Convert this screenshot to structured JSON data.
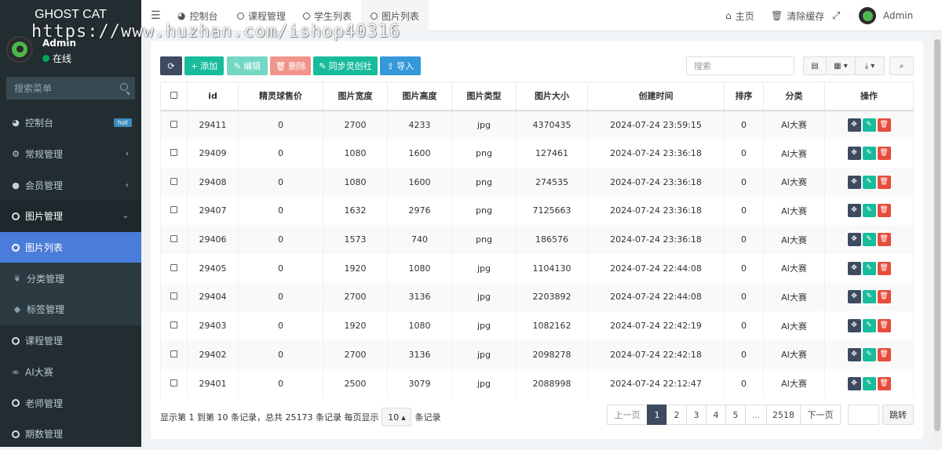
{
  "app": {
    "title": "GHOST CAT",
    "watermark": "https://www.huzhan.com/ishop40316"
  },
  "user": {
    "name": "Admin",
    "status": "在线"
  },
  "sidebar": {
    "search_placeholder": "搜索菜单",
    "items": [
      {
        "label": "控制台",
        "icon": "dashboard-icon",
        "badge": "hot"
      },
      {
        "label": "常规管理",
        "icon": "cogs-icon"
      },
      {
        "label": "会员管理",
        "icon": "user-circle-icon"
      },
      {
        "label": "图片管理",
        "icon": "circle-icon"
      },
      {
        "label": "图片列表",
        "icon": "circle-icon"
      },
      {
        "label": "分类管理",
        "icon": "leaf-icon"
      },
      {
        "label": "标签管理",
        "icon": "tag-icon"
      },
      {
        "label": "课程管理",
        "icon": "circle-icon"
      },
      {
        "label": "AI大赛",
        "icon": "binoculars-icon"
      },
      {
        "label": "老师管理",
        "icon": "circle-icon"
      },
      {
        "label": "期数管理",
        "icon": "circle-icon"
      }
    ]
  },
  "topbar": {
    "tabs": [
      "控制台",
      "课程管理",
      "学生列表",
      "图片列表"
    ],
    "home": "主页",
    "clear_cache": "清除缓存",
    "admin": "Admin"
  },
  "toolbar": {
    "add": "添加",
    "edit": "编辑",
    "delete": "删除",
    "sync": "同步灵创社",
    "import": "导入",
    "search_placeholder": "搜索",
    "colors": {
      "primary": "#3d4a60",
      "success": "#18bc9c",
      "danger": "#e74c3c",
      "info": "#3498db"
    }
  },
  "table": {
    "headers": [
      "id",
      "精灵球售价",
      "图片宽度",
      "图片高度",
      "图片类型",
      "图片大小",
      "创建时间",
      "排序",
      "分类",
      "操作"
    ],
    "rows": [
      [
        "29411",
        "0",
        "2700",
        "4233",
        "jpg",
        "4370435",
        "2024-07-24 23:59:15",
        "0",
        "AI大赛"
      ],
      [
        "29409",
        "0",
        "1080",
        "1600",
        "png",
        "127461",
        "2024-07-24 23:36:18",
        "0",
        "AI大赛"
      ],
      [
        "29408",
        "0",
        "1080",
        "1600",
        "png",
        "274535",
        "2024-07-24 23:36:18",
        "0",
        "AI大赛"
      ],
      [
        "29407",
        "0",
        "1632",
        "2976",
        "png",
        "7125663",
        "2024-07-24 23:36:18",
        "0",
        "AI大赛"
      ],
      [
        "29406",
        "0",
        "1573",
        "740",
        "png",
        "186576",
        "2024-07-24 23:36:18",
        "0",
        "AI大赛"
      ],
      [
        "29405",
        "0",
        "1920",
        "1080",
        "jpg",
        "1104130",
        "2024-07-24 22:44:08",
        "0",
        "AI大赛"
      ],
      [
        "29404",
        "0",
        "2700",
        "3136",
        "jpg",
        "2203892",
        "2024-07-24 22:44:08",
        "0",
        "AI大赛"
      ],
      [
        "29403",
        "0",
        "1920",
        "1080",
        "jpg",
        "1082162",
        "2024-07-24 22:42:19",
        "0",
        "AI大赛"
      ],
      [
        "29402",
        "0",
        "2700",
        "3136",
        "jpg",
        "2098278",
        "2024-07-24 22:42:18",
        "0",
        "AI大赛"
      ],
      [
        "29401",
        "0",
        "2500",
        "3079",
        "jpg",
        "2088998",
        "2024-07-24 22:12:47",
        "0",
        "AI大赛"
      ]
    ]
  },
  "footer": {
    "summary": "显示第 1 到第 10 条记录，总共 25173 条记录 每页显示",
    "page_size": "10",
    "suffix": "条记录",
    "pages": [
      "上一页",
      "1",
      "2",
      "3",
      "4",
      "5",
      "...",
      "2518",
      "下一页"
    ],
    "current_page": "1",
    "jump": "跳转"
  }
}
